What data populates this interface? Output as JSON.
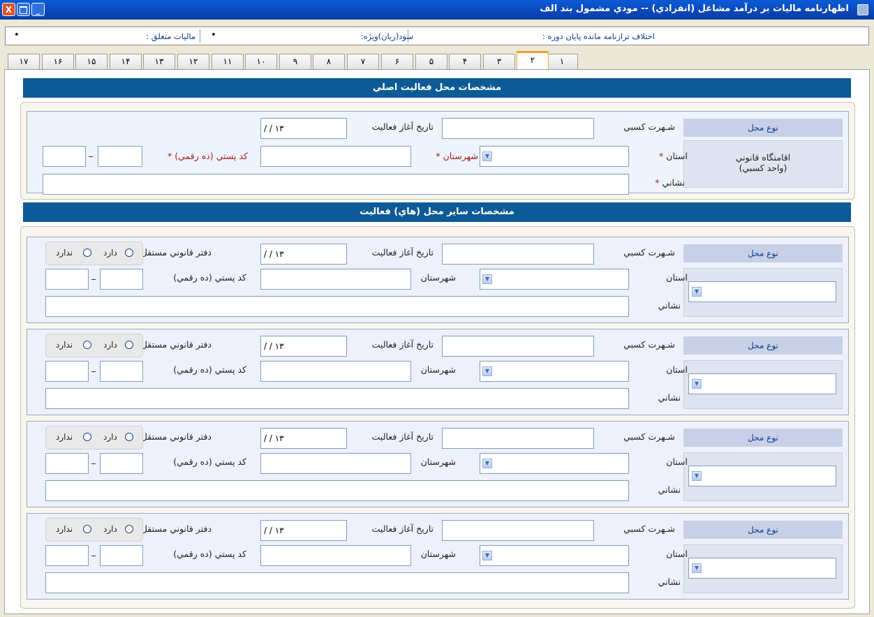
{
  "window": {
    "title": "اظهارنامه ماليات بر درآمد مشاغل (انفرادي) -- مودي مشمول بند الف",
    "close_glyph": "X",
    "min_glyph": "_"
  },
  "summary": {
    "discrepancy_label": "اختلاف ترازنامه مانده پايان دوره :",
    "profit_label": "سود(زيان)ويژه:",
    "profit_value": "•",
    "tax_label": "ماليات متعلق :",
    "tax_value": "•",
    "left_value": "•"
  },
  "tabs": [
    "١",
    "٢",
    "٣",
    "۴",
    "۵",
    "۶",
    "٧",
    "٨",
    "٩",
    "١٠",
    "١١",
    "١٢",
    "١٣",
    "١۴",
    "١۵",
    "١۶",
    "١٧"
  ],
  "active_tab": "٢",
  "main_section": {
    "title": "مشخصات محل فعاليت اصلي",
    "place_type_label": "نوع محل",
    "place_type_value": "اقامتگاه قانوني",
    "place_type_sub": "(واحد كسبي)",
    "business_name_label": "شـهرت كسبي",
    "start_date_label": "تاريخ آغاز فعاليت",
    "date_value": "/ / ١٣",
    "province_label": "استان",
    "city_label": "شهرستان",
    "postal_label": "كد پستي (ده رقمي)",
    "address_label": "نشاني",
    "required_mark": "*"
  },
  "other_section": {
    "title": "مشخصات ساير محل (هاي) فعاليت",
    "place_type_label": "نوع محل",
    "business_name_label": "شـهرت كسبي",
    "start_date_label": "تاريخ آغاز فعاليت",
    "date_value": "/ / ١٣",
    "legal_office_label": "دفتر قانوني مستقل",
    "has_label": "دارد",
    "has_not_label": "ندارد",
    "province_label": "استان",
    "city_label": "شهرستان",
    "postal_label": "كد پستي (ده رقمي)",
    "address_label": "نشاني"
  },
  "icons": {
    "app": "app-icon",
    "dropdown": "chevron-down-icon"
  }
}
